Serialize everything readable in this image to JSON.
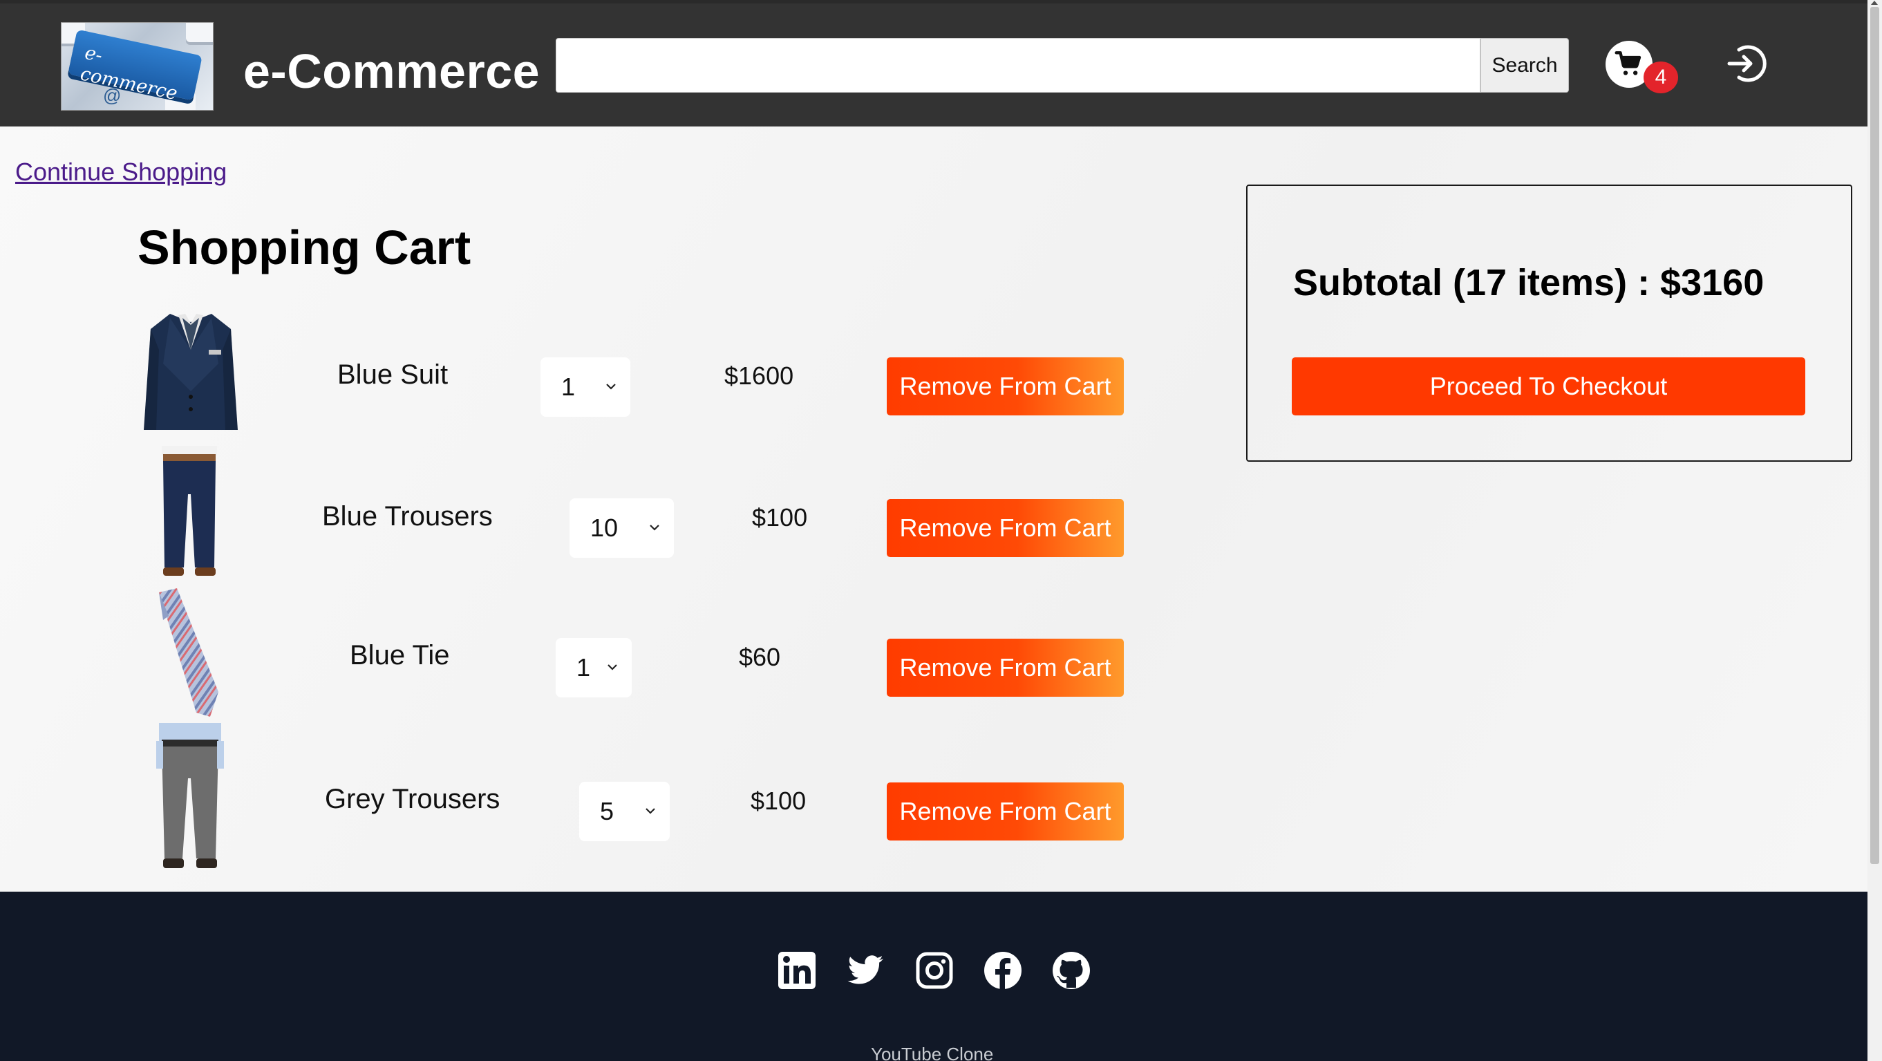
{
  "header": {
    "logo_text": "e-commerce",
    "brand": "e-Commerce",
    "search_placeholder": "",
    "search_button": "Search",
    "cart_count": "4",
    "icons": [
      "cart-icon",
      "login-icon"
    ]
  },
  "main": {
    "continue_link": "Continue Shopping",
    "title": "Shopping Cart",
    "items": [
      {
        "name": "Blue Suit",
        "qty": "1",
        "price": "$1600",
        "remove": "Remove From Cart",
        "image": "blue-suit-image"
      },
      {
        "name": "Blue Trousers",
        "qty": "10",
        "price": "$100",
        "remove": "Remove From Cart",
        "image": "blue-trousers-image"
      },
      {
        "name": "Blue Tie",
        "qty": "1",
        "price": "$60",
        "remove": "Remove From Cart",
        "image": "blue-tie-image"
      },
      {
        "name": "Grey Trousers",
        "qty": "5",
        "price": "$100",
        "remove": "Remove From Cart",
        "image": "grey-trousers-image"
      }
    ]
  },
  "summary": {
    "subtotal": "Subtotal (17 items) : $3160",
    "checkout": "Proceed To Checkout"
  },
  "footer": {
    "icons": [
      "linkedin-icon",
      "twitter-icon",
      "instagram-icon",
      "facebook-icon",
      "github-icon"
    ],
    "text": "YouTube Clone"
  },
  "colors": {
    "header_bg": "#333333",
    "accent": "#ff3900",
    "badge": "#e3242b",
    "footer_bg": "#111827"
  }
}
